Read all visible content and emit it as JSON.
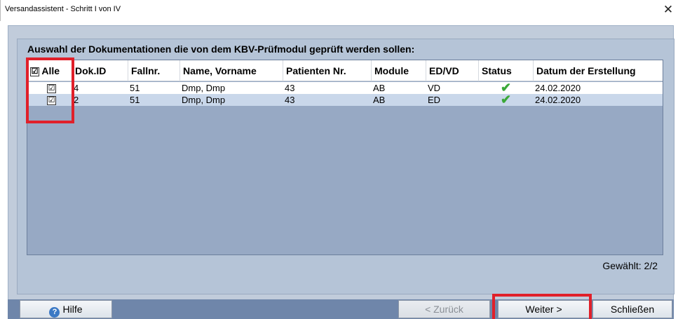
{
  "window": {
    "title": "Versandassistent - Schritt I von IV",
    "close_glyph": "✕"
  },
  "heading": "Auswahl der Dokumentationen die von dem KBV-Prüfmodul geprüft werden sollen:",
  "table": {
    "columns": [
      "Alle",
      "Dok.ID",
      "Fallnr.",
      "Name, Vorname",
      "Patienten Nr.",
      "Module",
      "ED/VD",
      "Status",
      "Datum der Erstellung"
    ],
    "rows": [
      {
        "checked": "☑",
        "dok_id": "4",
        "fallnr": "51",
        "name": "Dmp, Dmp",
        "patienten_nr": "43",
        "module": "AB",
        "ed_vd": "VD",
        "status": "✔",
        "datum": "24.02.2020"
      },
      {
        "checked": "☑",
        "dok_id": "2",
        "fallnr": "51",
        "name": "Dmp, Dmp",
        "patienten_nr": "43",
        "module": "AB",
        "ed_vd": "ED",
        "status": "✔",
        "datum": "24.02.2020"
      }
    ],
    "header_checkbox": "☑"
  },
  "selected_text": "Gewählt: 2/2",
  "buttons": {
    "help": "Hilfe",
    "back": "< Zurück",
    "next": "Weiter >",
    "close": "Schließen"
  },
  "icons": {
    "help": "help-icon",
    "status": "check-icon"
  },
  "colors": {
    "highlight": "#e0202a",
    "status_ok": "#3aa838"
  }
}
